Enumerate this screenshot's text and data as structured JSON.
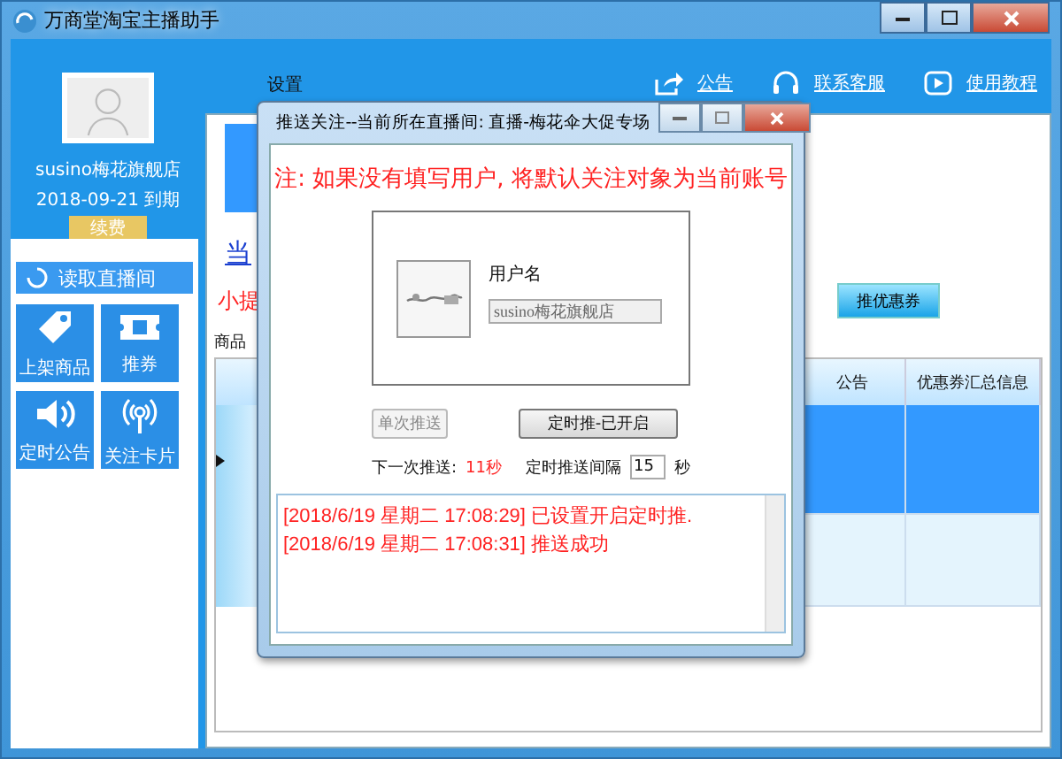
{
  "window": {
    "title": "万商堂淘宝主播助手"
  },
  "account": {
    "name": "susino梅花旗舰店",
    "expiry": "2018-09-21 到期",
    "renew_button": "续费"
  },
  "sidebar": {
    "read_button": "读取直播间",
    "tiles": [
      {
        "label": "上架商品",
        "kind": "tag"
      },
      {
        "label": "推券",
        "kind": "ticket"
      },
      {
        "label": "定时公告",
        "kind": "speaker"
      },
      {
        "label": "关注卡片",
        "kind": "broadcast"
      }
    ]
  },
  "header": {
    "settings": "设置",
    "links": [
      {
        "label": "公告",
        "kind": "share"
      },
      {
        "label": "联系客服",
        "kind": "headset"
      },
      {
        "label": "使用教程",
        "kind": "play"
      }
    ]
  },
  "main": {
    "link": "当",
    "tip": "小提",
    "tab": "商品",
    "coupon_button": "推优惠券",
    "table": {
      "columns": [
        "公告",
        "优惠券汇总信息"
      ],
      "rows": [
        {
          "selected": true
        },
        {
          "selected": false
        }
      ]
    }
  },
  "dialog": {
    "title": "推送关注--当前所在直播间: 直播-梅花伞大促专场",
    "note": "注: 如果没有填写用户, 将默认关注对象为当前账号",
    "username_label": "用户名",
    "username": "susino梅花旗舰店",
    "single_button": {
      "label": "单次推送",
      "disabled": true
    },
    "timer_button": {
      "label": "定时推-已开启",
      "disabled": false
    },
    "next_label": "下一次推送:",
    "next_value": "11秒",
    "interval_label": "定时推送间隔",
    "interval": "15",
    "interval_unit": "秒",
    "log": [
      "[2018/6/19 星期二 17:08:29] 已设置开启定时推.",
      "[2018/6/19 星期二 17:08:31] 推送成功"
    ]
  }
}
